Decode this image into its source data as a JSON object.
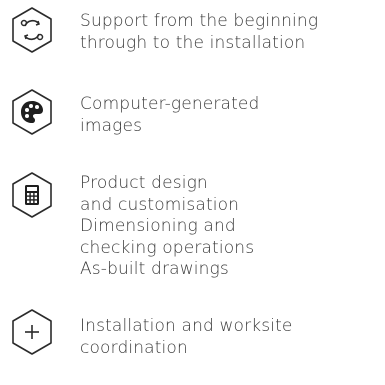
{
  "features": [
    {
      "icon": "cycle-arrows-icon",
      "lines": [
        "Support from the beginning",
        "through to the installation"
      ]
    },
    {
      "icon": "palette-icon",
      "lines": [
        "Computer-generated",
        "images"
      ]
    },
    {
      "icon": "calculator-icon",
      "lines": [
        "Product design",
        "and customisation",
        "Dimensioning and",
        "checking operations",
        "As-built drawings"
      ]
    },
    {
      "icon": "plus-icon",
      "lines": [
        "Installation and worksite",
        "coordination"
      ]
    }
  ],
  "colors": {
    "text": "#3a3a3a",
    "icon_stroke": "#2b2b2b"
  }
}
